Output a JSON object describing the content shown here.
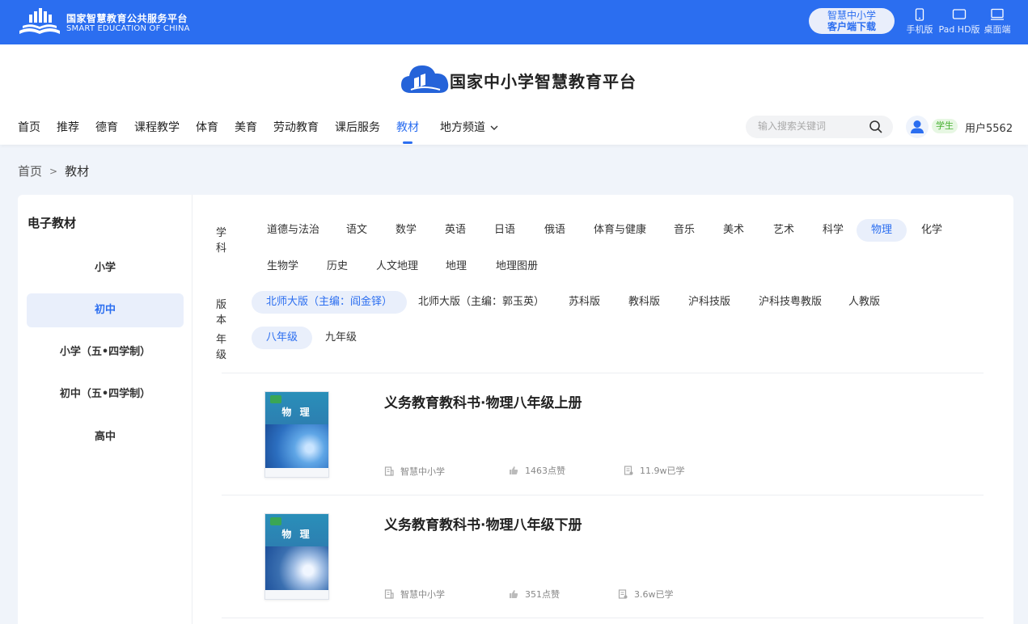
{
  "topbar": {
    "brand_cn": "国家智慧教育公共服务平台",
    "brand_en": "SMART EDUCATION OF CHINA",
    "download_line1": "智慧中小学",
    "download_line2": "客户端下载",
    "devices": [
      {
        "label": "手机版",
        "icon": "phone-icon"
      },
      {
        "label": "Pad HD版",
        "icon": "tablet-icon"
      },
      {
        "label": "桌面端",
        "icon": "desktop-icon"
      }
    ],
    "color": "#2b6ef0"
  },
  "header": {
    "site_title": "国家中小学智慧教育平台",
    "nav": [
      "首页",
      "推荐",
      "德育",
      "课程教学",
      "体育",
      "美育",
      "劳动教育",
      "课后服务",
      "教材",
      "地方频道"
    ],
    "active_nav": "教材",
    "search_placeholder": "输入搜索关键词",
    "role_badge": "学生",
    "username": "用户5562"
  },
  "breadcrumb": {
    "home": "首页",
    "separator": ">",
    "current": "教材"
  },
  "sidebar": {
    "title": "电子教材",
    "stages": [
      "小学",
      "初中",
      "小学（五•四学制）",
      "初中（五•四学制）",
      "高中"
    ],
    "active_stage": "初中"
  },
  "filters": {
    "subject_label": "学科",
    "subjects_row1": [
      "道德与法治",
      "语文",
      "数学",
      "英语",
      "日语",
      "俄语",
      "体育与健康",
      "音乐",
      "美术",
      "艺术",
      "科学",
      "物理",
      "化学"
    ],
    "subjects_row2": [
      "生物学",
      "历史",
      "人文地理",
      "地理",
      "地理图册"
    ],
    "active_subject": "物理",
    "version_label": "版本",
    "versions": [
      "北师大版（主编：阎金铎）",
      "北师大版（主编：郭玉英）",
      "苏科版",
      "教科版",
      "沪科技版",
      "沪科技粤教版",
      "人教版"
    ],
    "active_version": "北师大版（主编：阎金铎）",
    "grade_label": "年级",
    "grades": [
      "八年级",
      "九年级"
    ],
    "active_grade": "八年级"
  },
  "books": [
    {
      "title": "义务教育教科书·物理八年级上册",
      "cover_title": "物 理",
      "publisher": "智慧中小学",
      "likes": "1463点赞",
      "learned": "11.9w已学"
    },
    {
      "title": "义务教育教科书·物理八年级下册",
      "cover_title": "物 理",
      "publisher": "智慧中小学",
      "likes": "351点赞",
      "learned": "3.6w已学"
    }
  ]
}
